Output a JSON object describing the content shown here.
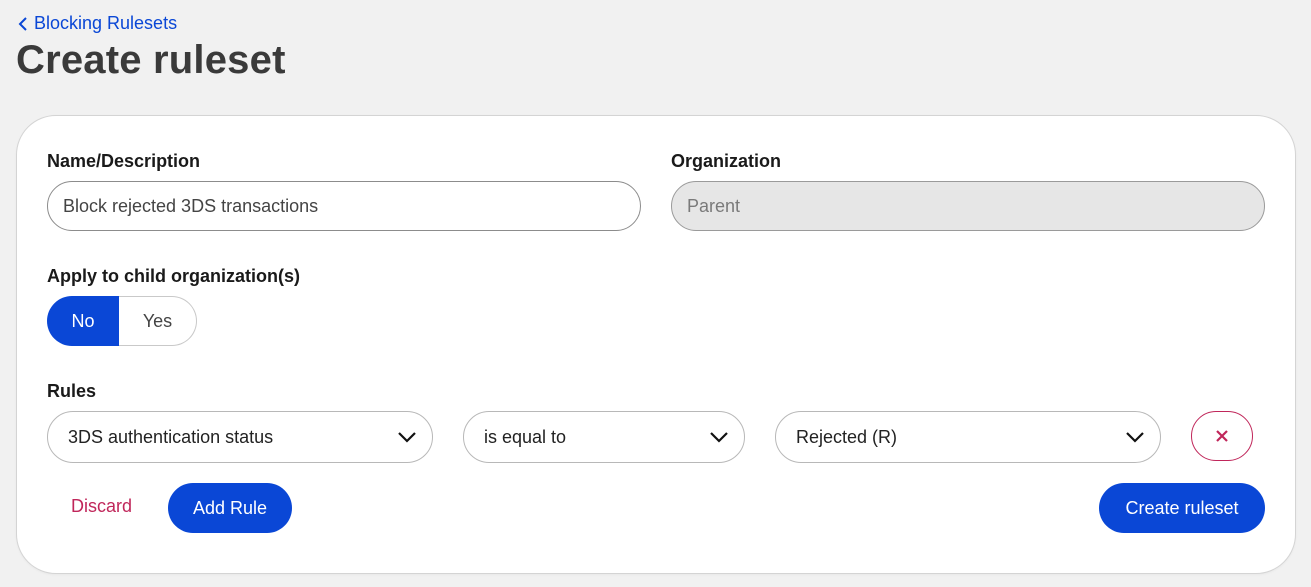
{
  "breadcrumb": {
    "label": "Blocking Rulesets",
    "icon": "chevron-left-icon"
  },
  "page": {
    "title": "Create ruleset"
  },
  "form": {
    "name_label": "Name/Description",
    "name_value": "Block rejected 3DS transactions",
    "org_label": "Organization",
    "org_value": "Parent",
    "apply_label": "Apply to child organization(s)",
    "apply_options": {
      "no": "No",
      "yes": "Yes",
      "selected": "No"
    },
    "rules_label": "Rules",
    "rule": {
      "field": "3DS authentication status",
      "operator": "is equal to",
      "value": "Rejected (R)",
      "remove_icon": "close-icon",
      "dropdown_icon": "chevron-down-icon"
    }
  },
  "actions": {
    "discard": "Discard",
    "add_rule": "Add Rule",
    "create": "Create ruleset"
  },
  "colors": {
    "primary": "#0a47d6",
    "danger": "#c0265a",
    "background": "#f1f1f1"
  }
}
